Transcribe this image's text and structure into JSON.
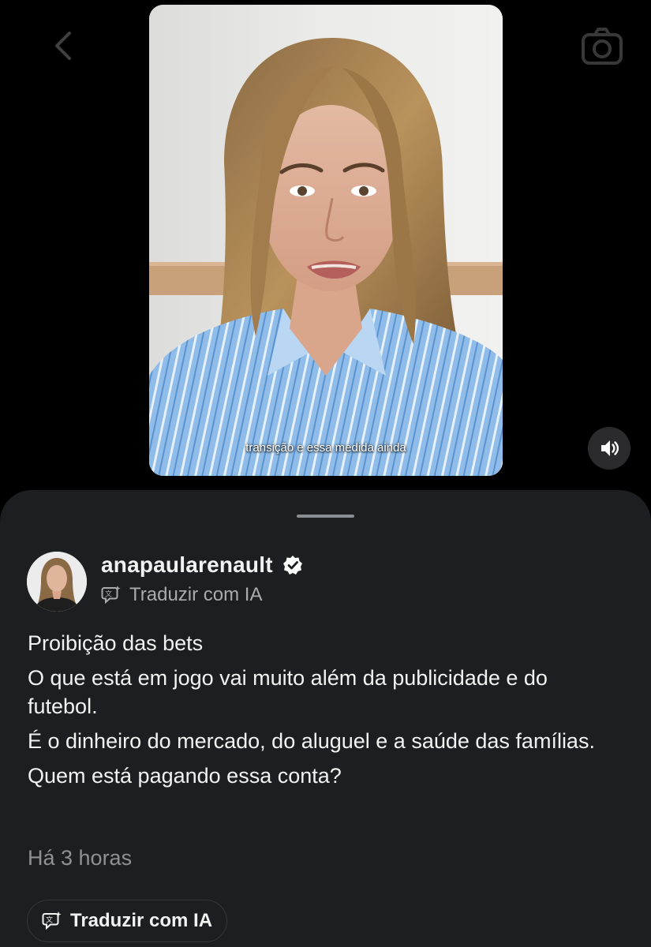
{
  "video": {
    "caption": "transição e essa medida ainda"
  },
  "post": {
    "username": "anapaularenault",
    "translate_label": "Traduzir com IA",
    "paragraphs": [
      "Proibição das bets",
      "O que está em jogo vai muito além da publicidade e do futebol.",
      "É o dinheiro do mercado, do aluguel e a saúde das famílias.",
      "Quem está pagando essa conta?"
    ],
    "timestamp": "Há 3 horas",
    "translate_button_label": "Traduzir com IA"
  },
  "icons": {
    "back": "chevron-left-icon",
    "camera": "camera-icon",
    "mute": "speaker-icon",
    "verified": "verified-badge-icon",
    "translate": "ai-translate-icon"
  },
  "colors": {
    "background": "#000000",
    "sheet": "#1c1e21",
    "text_primary": "#f2f2f2",
    "text_secondary": "#8e9196",
    "verified_badge": "#ffffff"
  }
}
